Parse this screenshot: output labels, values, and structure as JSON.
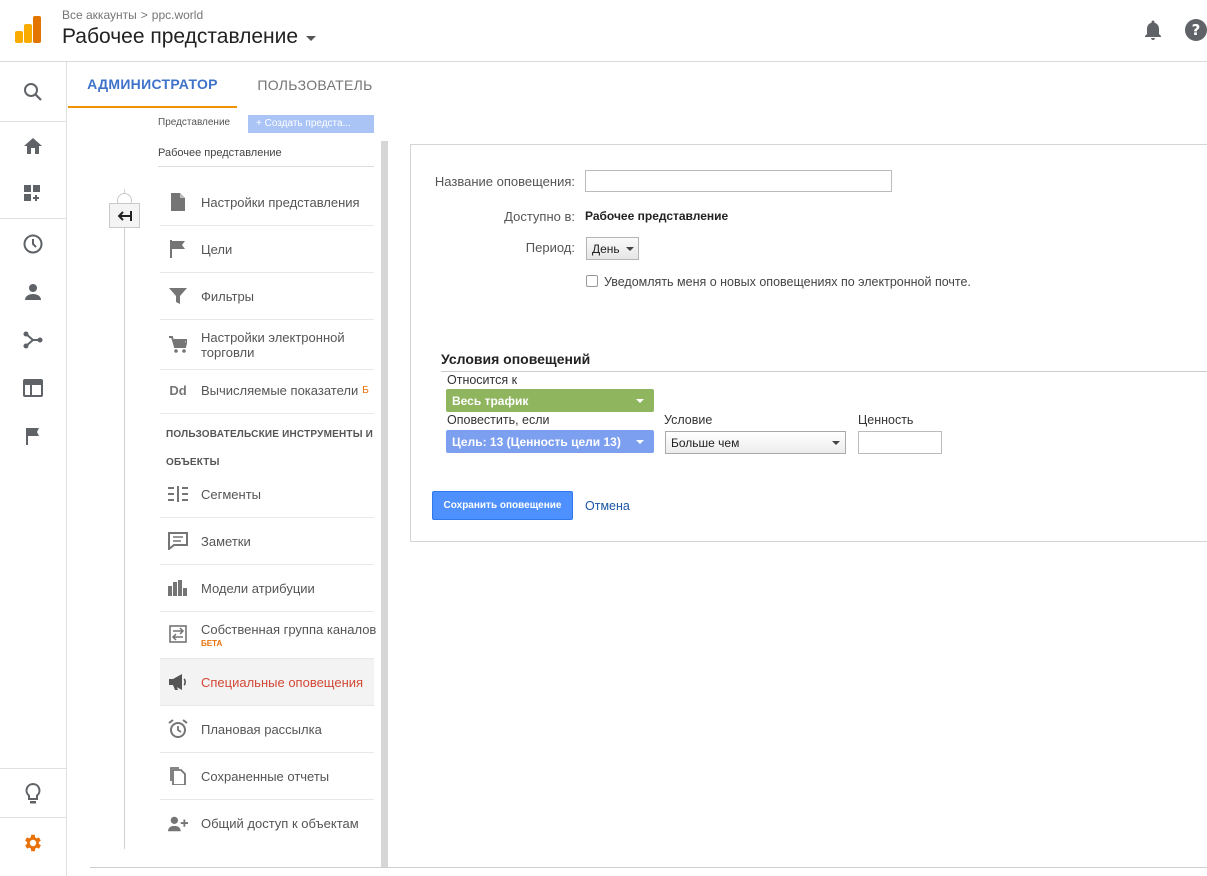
{
  "header": {
    "breadcrumb_all": "Все аккаунты",
    "breadcrumb_sep": ">",
    "breadcrumb_account": "ppc.world",
    "view_title": "Рабочее представление",
    "icons": [
      "notifications-icon",
      "help-icon"
    ]
  },
  "rail": {
    "items": [
      "search-icon",
      "home-icon",
      "customization-icon",
      "realtime-icon",
      "audience-icon",
      "acquisition-icon",
      "behavior-icon",
      "conversions-icon",
      "discover-icon",
      "admin-gear-icon"
    ]
  },
  "tabs": [
    {
      "label": "АДМИНИСТРАТОР",
      "active": true
    },
    {
      "label": "ПОЛЬЗОВАТЕЛЬ",
      "active": false
    }
  ],
  "admin_column": {
    "top_label": "Представление",
    "top_button": "+ Создать предста...",
    "view_name": "Рабочее представление",
    "items": [
      {
        "label": "Настройки представления",
        "icon": "page-icon"
      },
      {
        "label": "Цели",
        "icon": "flag-icon"
      },
      {
        "label": "Фильтры",
        "icon": "filter-icon"
      },
      {
        "label": "Настройки электронной",
        "label2": "торговли",
        "icon": "cart-icon"
      },
      {
        "label": "Вычисляемые показатели",
        "suffix": "Б",
        "icon": "dd-icon"
      }
    ],
    "section_1": "ПОЛЬЗОВАТЕЛЬСКИЕ ИНСТРУМЕНТЫ И",
    "section_2": "ОБЪЕКТЫ",
    "items2": [
      {
        "label": "Сегменты",
        "icon": "segments-icon"
      },
      {
        "label": "Заметки",
        "icon": "annotations-icon"
      },
      {
        "label": "Модели атрибуции",
        "icon": "attribution-icon"
      },
      {
        "label": "Собственная группа каналов",
        "badge": "БЕТА",
        "icon": "channel-grouping-icon"
      },
      {
        "label": "Специальные оповещения",
        "icon": "megaphone-icon",
        "active": true
      },
      {
        "label": "Плановая рассылка",
        "icon": "alarm-icon"
      },
      {
        "label": "Сохраненные отчеты",
        "icon": "saved-reports-icon"
      },
      {
        "label": "Общий доступ к объектам",
        "icon": "share-assets-icon"
      }
    ]
  },
  "form": {
    "alert_name_label": "Название оповещения:",
    "alert_name_value": "",
    "available_label": "Доступно в:",
    "available_value": "Рабочее представление",
    "period_label": "Период:",
    "period_value": "День",
    "email_checkbox_label": "Уведомлять меня о новых оповещениях по электронной почте.",
    "email_checked": false,
    "conditions_title": "Условия оповещений",
    "applies_to_label": "Относится к",
    "applies_to_value": "Весь трафик",
    "alert_if_label": "Оповестить, если",
    "alert_if_value": "Цель: 13 (Ценность цели 13)",
    "condition_label": "Условие",
    "condition_value": "Больше чем",
    "value_label": "Ценность",
    "value_value": "",
    "save_button": "Сохранить оповещение",
    "cancel_link": "Отмена"
  },
  "colors": {
    "accent_blue": "#3f72c9",
    "tab_underline": "#f09300",
    "active_red": "#d34836",
    "pill_green": "#8fb55f",
    "pill_blue": "#7c9ff0",
    "save_blue": "#4d90fe"
  }
}
